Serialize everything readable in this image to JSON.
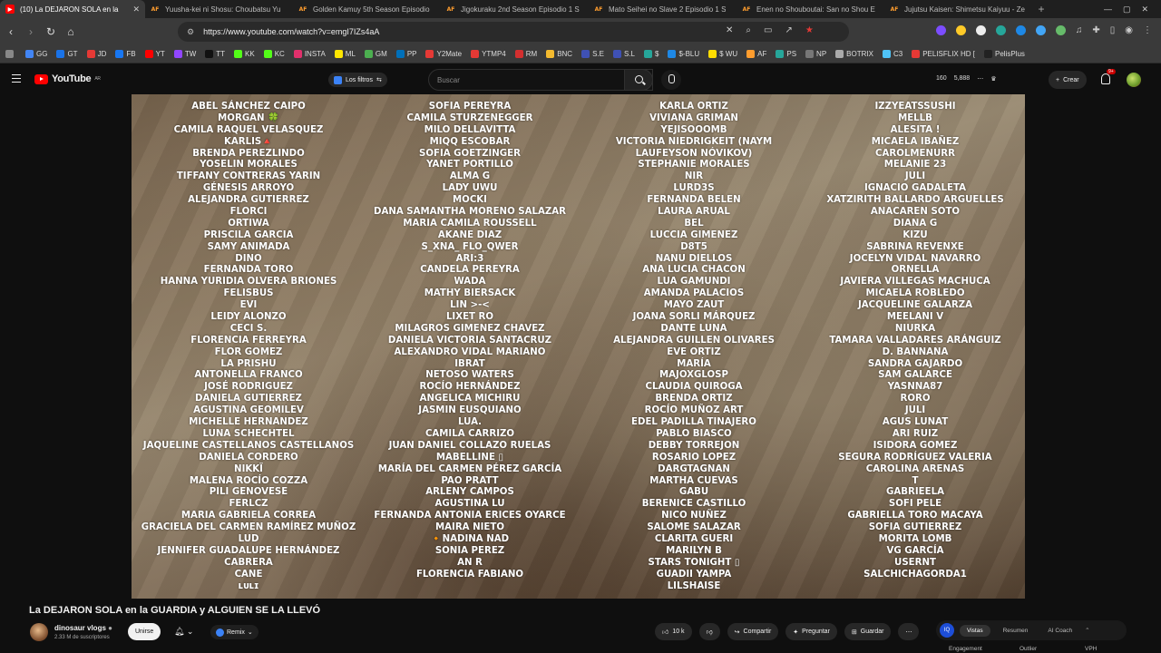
{
  "browser": {
    "tabs": [
      {
        "icon": "youtube-icon",
        "title": "(10) La DEJARON SOLA en la",
        "active": true
      },
      {
        "icon": "af-icon",
        "title": "Yuusha-kei ni Shosu: Choubatsu Yu"
      },
      {
        "icon": "af-icon",
        "title": "Golden Kamuy 5th Season Episodio"
      },
      {
        "icon": "af-icon",
        "title": "Jigokuraku 2nd Season Episodio 1 S"
      },
      {
        "icon": "af-icon",
        "title": "Mato Seihei no Slave 2 Episodio 1 S"
      },
      {
        "icon": "af-icon",
        "title": "Enen no Shouboutai: San no Shou E"
      },
      {
        "icon": "af-icon",
        "title": "Jujutsu Kaisen: Shimetsu Kaiyuu - Ze"
      }
    ],
    "url": "https://www.youtube.com/watch?v=emgI7IZs4aA",
    "bookmarks": [
      {
        "label": "",
        "color": "#888888"
      },
      {
        "label": "GG",
        "color": "#4285f4"
      },
      {
        "label": "GT",
        "color": "#1a73e8"
      },
      {
        "label": "JD",
        "color": "#e53935"
      },
      {
        "label": "FB",
        "color": "#1877f2"
      },
      {
        "label": "YT",
        "color": "#ff0000"
      },
      {
        "label": "TW",
        "color": "#9146ff"
      },
      {
        "label": "TT",
        "color": "#111111"
      },
      {
        "label": "KK",
        "color": "#53fc18"
      },
      {
        "label": "KC",
        "color": "#53fc18"
      },
      {
        "label": "INSTA",
        "color": "#e1306c"
      },
      {
        "label": "ML",
        "color": "#ffe600"
      },
      {
        "label": "GM",
        "color": "#4caf50"
      },
      {
        "label": "PP",
        "color": "#0070ba"
      },
      {
        "label": "Y2Mate",
        "color": "#e53935"
      },
      {
        "label": "YTMP4",
        "color": "#e53935"
      },
      {
        "label": "RM",
        "color": "#d32f2f"
      },
      {
        "label": "BNC",
        "color": "#f3ba2f"
      },
      {
        "label": "S.E",
        "color": "#3f51b5"
      },
      {
        "label": "S.L",
        "color": "#3f51b5"
      },
      {
        "label": "$",
        "color": "#26a69a"
      },
      {
        "label": "$-BLU",
        "color": "#1e88e5"
      },
      {
        "label": "$ WU",
        "color": "#ffdd00"
      },
      {
        "label": "AF",
        "color": "#ff9d2e"
      },
      {
        "label": "PS",
        "color": "#26a69a"
      },
      {
        "label": "NP",
        "color": "#777777"
      },
      {
        "label": "BOTRIX",
        "color": "#aaaaaa"
      },
      {
        "label": "C3",
        "color": "#4fc3f7"
      },
      {
        "label": "PELISFLIX HD [",
        "color": "#e53935"
      },
      {
        "label": "PelisPlus",
        "color": "#222222"
      }
    ]
  },
  "youtube": {
    "logo": "YouTube",
    "logo_region": "AR",
    "filters_label": "Los filtros",
    "search_placeholder": "Buscar",
    "header_stats": [
      "160",
      "5,888"
    ],
    "create_label": "Crear",
    "notif_badge": "9+"
  },
  "credits": {
    "col1": [
      "ABEL SÁNCHEZ CAIPO",
      "MORGAN 🍀",
      "CAMILA RAQUEL VELASQUEZ",
      "KARLIS🔺",
      "BRENDA PEREZLINDO",
      "YOSELIN MORALES",
      "TIFFANY  CONTRERAS YARIN",
      "GÉNESIS ARROYO",
      "ALEJANDRA GUTIERREZ",
      "FLORCI",
      "ORTIWA",
      "PRISCILA GARCIA",
      "SAMY ANIMADA",
      "DINO",
      "FERNANDA TORO",
      "HANNA YURIDIA OLVERA BRIONES",
      "FELISBUS",
      "EVI",
      "LEIDY ALONZO",
      "CECI S.",
      "FLORENCIA FERREYRA",
      "FLOR GOMEZ",
      "LA PRISHU",
      "ANTONELLA FRANCO",
      "JOSÉ RODRIGUEZ",
      "DANIELA GUTIERREZ",
      "AGUSTINA GEOMILEV",
      "MICHELLE HERNANDEZ",
      "LUNA SCHECHTEL",
      "JAQUELINE CASTELLANOS CASTELLANOS",
      "DANIELA CORDERO",
      "NIKKÏ",
      "MALENA ROCÍO COZZA",
      "PILI GENOVESE",
      "FERLCZ",
      "MARIA GABRIELA CORREA",
      "GRACIELA DEL CARMEN RAMÍREZ MUÑOZ",
      "LUD",
      "JENNIFER GUADALUPE HERNÁNDEZ",
      "CABRERA",
      "CANE",
      "ʟᴜʟɪ"
    ],
    "col2": [
      "SOFIA PEREYRA",
      "CAMILA STURZENEGGER",
      "MILO DELLAVITTA",
      "MIQQ ESCOBAR",
      "SOFIA GOETZINGER",
      "YANET PORTILLO",
      "ALMA G",
      "LADY UWU",
      "MOCKI",
      "DANA SAMANTHA MORENO SALAZAR",
      "MARIA CAMILA ROUSSELL",
      "AKANE DIAZ",
      "S_XNA_ FLO_QWER",
      "ARI:3",
      "CANDELA PEREYRA",
      "WADA",
      "MATHY BIERSACK",
      "LIN >-<",
      "LIXET RO",
      "MILAGROS GIMENEZ CHAVEZ",
      "DANIELA VICTORIA SANTACRUZ",
      "ALEXANDRO VIDAL MARIANO",
      "IBRAT",
      "NETOSO WATERS",
      "ROCÍO HERNÁNDEZ",
      "ANGELICA MICHIRU",
      "JASMIN EUSQUIANO",
      "LUA.",
      "CAMILA CARRIZO",
      "JUAN DANIEL COLLAZO RUELAS",
      "MABELLINE ▯",
      "MARÍA DEL CARMEN PÉREZ GARCÍA",
      "PAO PRATT",
      "ARLENY CAMPOS",
      "AGUSTINA LU",
      "FERNANDA ANTONIA ERICES OYARCE",
      "MAIRA NIETO",
      "🔸NADINA NAD",
      "SONIA PEREZ",
      "AN R",
      "FLORENCIA FABIANO"
    ],
    "col3": [
      "KARLA ORTIZ",
      "VIVIANA GRIMAN",
      "YEJISOOOMB",
      "VICTORIA NIEDRIGKEIT (NAYM",
      "LAUFEYSON NÓVIKOV)",
      "STEPHANIE MORALES",
      "NIR",
      "LURD3S",
      "FERNANDA BELEN",
      "LAURA ARUAL",
      "BEL",
      "LUCCIA GIMENEZ",
      "D8T5",
      "NANU DIELLOS",
      "ANA LUCIA CHACON",
      "LUA GAMUNDI",
      "AMANDA PALACIOS",
      "MAYO ZAUT",
      "JOANA SORLI MÁRQUEZ",
      "DANTE LUNA",
      "ALEJANDRA GUILLEN OLIVARES",
      "EVE ORTIZ",
      "MARÍA",
      "MAJOXGLOSP",
      "CLAUDIA QUIROGA",
      "BRENDA ORTIZ",
      "ROCÍO MUÑOZ ART",
      "EDEL PADILLA TINAJERO",
      "PABLO BIASCO",
      "DEBBY TORREJON",
      "ROSARIO LOPEZ",
      "DARGTAGNAN",
      "MARTHA CUEVAS",
      "GABU",
      "BERENICE CASTILLO",
      "NICO NUÑEZ",
      "SALOME SALAZAR",
      "CLARITA GUERI",
      "MARILYN B",
      "STARS TONIGHT ▯",
      "GUADII YAMPA",
      "LILSHAISE"
    ],
    "col4": [
      "IZZYEATSSUSHI",
      "MELLB",
      "ALESITA !",
      "MICAELA IBAÑEZ",
      "CAROLMENURR",
      "MELANIE 23",
      "JULI",
      "IGNACIO GADALETA",
      "XATZIRITH BALLARDO ARGUELLES",
      "ANACAREN SOTO",
      "DIANA G",
      "KIZU",
      "SABRINA REVENXE",
      "JOCELYN VIDAL NAVARRO",
      "ORNELLA",
      "JAVIERA VILLEGAS MACHUCA",
      "MICAELA ROBLEDO",
      "JACQUELINE GALARZA",
      "MEELANI V",
      "NIURKA",
      "TAMARA VALLADARES ARÁNGUIZ",
      "D. BANNANA",
      "SANDRA GAJARDO",
      "SAM GALARCE",
      "YASNNA87",
      "RORO",
      "JULI",
      "AGUS LUNAT",
      "ARI RUIZ",
      "ISIDORA GOMEZ",
      "SEGURA RODRÍGUEZ VALERIA",
      "CAROLINA ARENAS",
      "T",
      "GABRIEELA",
      "SOFI PELE",
      "GABRIELLA TORO MACAYA",
      "SOFIA GUTIERREZ",
      "MORITA  LOMB",
      "VG GARCÍA",
      "USERNT",
      "SALCHICHAGORDA1"
    ]
  },
  "video_info": {
    "title": "La DEJARON SOLA en la GUARDIA y ALGUIEN SE LA LLEVÓ",
    "channel": "dinosaur vlogs",
    "subscribers": "2.33 M de suscriptores",
    "join_label": "Unirse",
    "remix_label": "Remix",
    "likes": "10 k",
    "share_label": "Compartir",
    "ask_label": "Preguntar",
    "save_label": "Guardar"
  },
  "side_panel": {
    "logo_text": "IQ",
    "tabs": [
      "Vistas",
      "Resumen",
      "AI Coach"
    ],
    "active_tab": "Vistas",
    "subtabs": [
      "Engagement",
      "Outlier",
      "VPH"
    ]
  }
}
